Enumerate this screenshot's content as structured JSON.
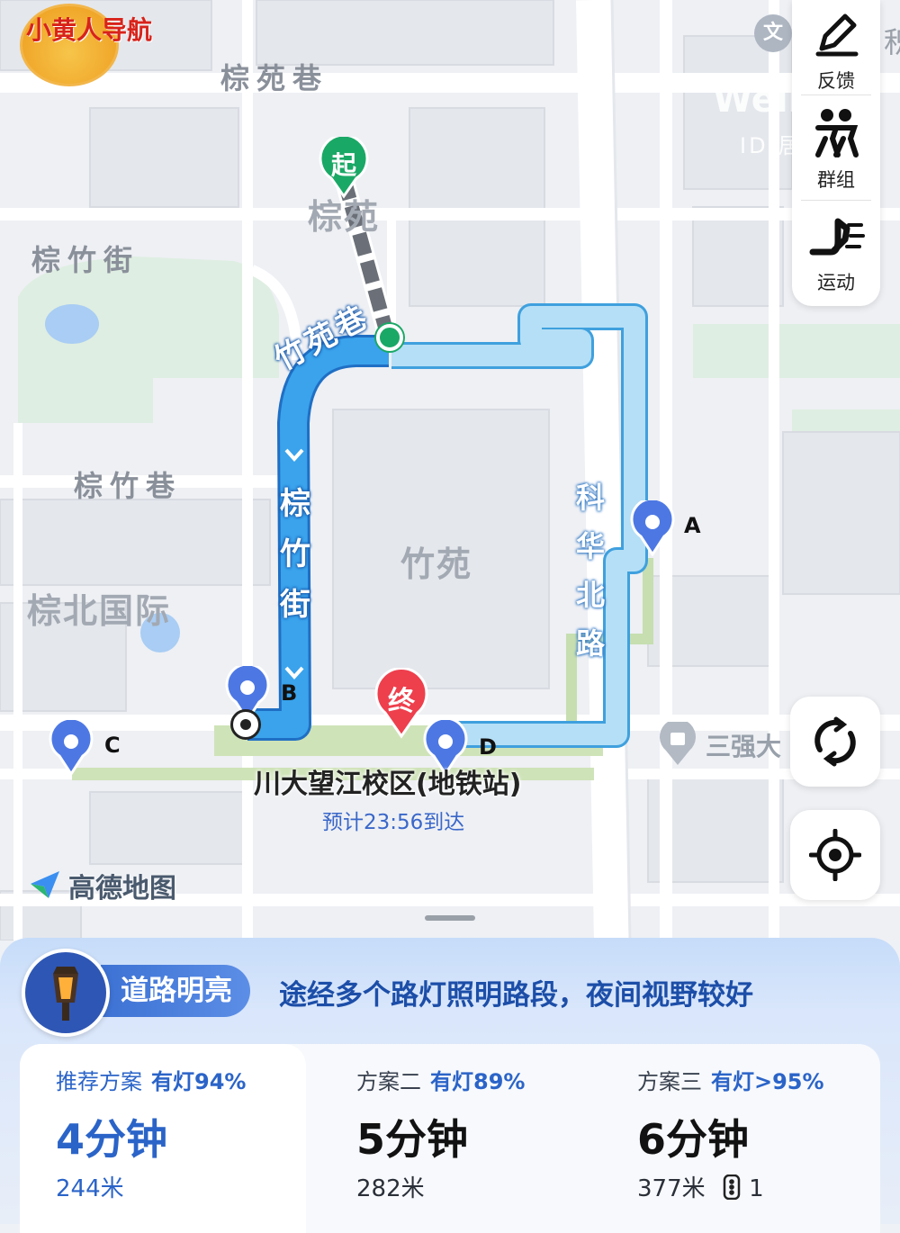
{
  "app_logo": {
    "text": "小黄人导航"
  },
  "map": {
    "street_labels": {
      "top": "棕苑巷",
      "left": "棕竹街",
      "middle_left": "棕竹巷"
    },
    "area_labels": {
      "start_area": "棕苑",
      "center": "竹苑",
      "left": "棕北国际",
      "right_poi": "三强大"
    },
    "route_labels": {
      "turn_street": "竹苑巷",
      "route_street": "棕竹街",
      "right_road": "科华北路"
    },
    "start_badge": "起",
    "end_badge": "终",
    "waypoints": [
      "A",
      "B",
      "C",
      "D"
    ],
    "destination": "川大望江校区(地铁站)",
    "eta": "预计23:56到达",
    "map_brand": "高德地图",
    "poi_badge": "文",
    "watermark": "Wellc",
    "watermark_sub": "ID:居",
    "edge_char": "积"
  },
  "side_panel": {
    "items": [
      {
        "label": "反馈",
        "icon": "pencil-icon"
      },
      {
        "label": "群组",
        "icon": "group-icon"
      },
      {
        "label": "运动",
        "icon": "running-icon"
      }
    ]
  },
  "buttons": {
    "refresh": "refresh-icon",
    "locate": "locate-icon"
  },
  "route_panel": {
    "tag": "道路明亮",
    "description": "途经多个路灯照明路段，夜间视野较好",
    "options": [
      {
        "name": "推荐方案",
        "light": "有灯94%",
        "time": "4分钟",
        "distance": "244米",
        "lights": ""
      },
      {
        "name": "方案二",
        "light": "有灯89%",
        "time": "5分钟",
        "distance": "282米",
        "lights": ""
      },
      {
        "name": "方案三",
        "light": "有灯>95%",
        "time": "6分钟",
        "distance": "377米",
        "lights": "1"
      }
    ]
  },
  "colors": {
    "route_main": "#39a2eb",
    "route_alt": "#a9d8f4",
    "accent": "#2b64c8",
    "start_green": "#1aa866",
    "end_red": "#ee3f4d",
    "pin_blue": "#4d78e4"
  }
}
